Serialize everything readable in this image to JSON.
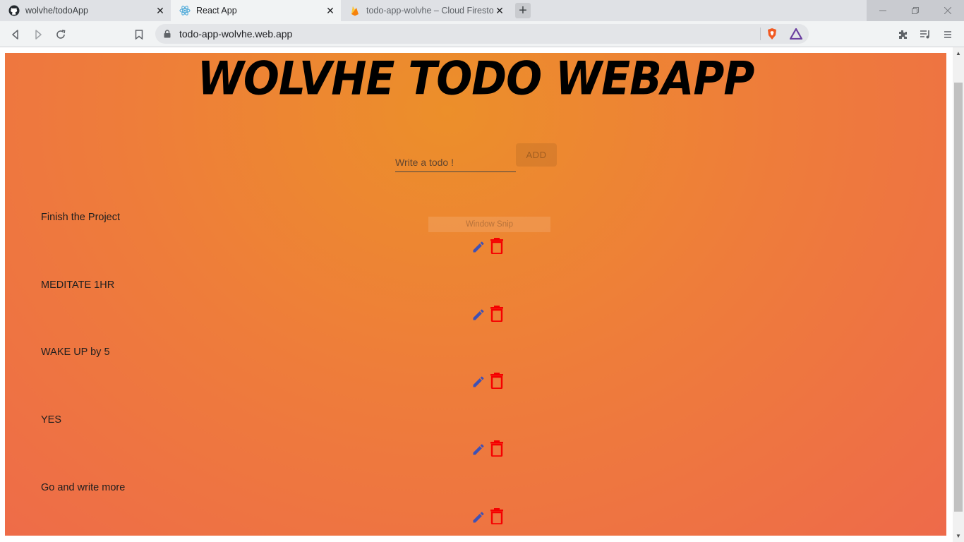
{
  "browser": {
    "tabs": [
      {
        "title": "wolvhe/todoApp",
        "icon": "github-icon",
        "active": false
      },
      {
        "title": "React App",
        "icon": "react-icon",
        "active": true
      },
      {
        "title": "todo-app-wolvhe – Cloud Firestore",
        "icon": "firebase-icon",
        "active": false
      }
    ],
    "close_glyph": "✕",
    "new_tab_glyph": "+",
    "address": "todo-app-wolvhe.web.app"
  },
  "app": {
    "title": "WOLVHE TODO WEBAPP",
    "input_placeholder": "Write a todo !",
    "input_value": "",
    "add_label": "ADD",
    "todos": [
      {
        "text": "Finish the Project"
      },
      {
        "text": "MEDITATE 1HR"
      },
      {
        "text": "WAKE UP by 5"
      },
      {
        "text": "YES"
      },
      {
        "text": "Go and write more"
      }
    ],
    "overlay_text": "Window Snip",
    "colors": {
      "edit": "#3f51b5",
      "delete": "#f50000",
      "bg_top": "#ec8f2a",
      "bg_bottom": "#ee6a4a"
    }
  }
}
